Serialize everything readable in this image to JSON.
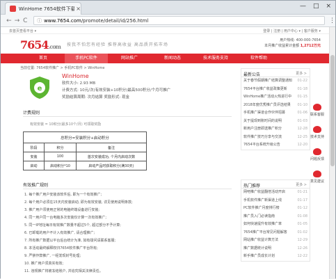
{
  "browser": {
    "tab_title": "WinHome 7654软件下载...",
    "close": "×",
    "window_controls": [
      "—",
      "□",
      "×"
    ],
    "url_host": "www.7654.com",
    "url_path": "/promote/detail/id/256.html",
    "back": "←",
    "forward": "→",
    "reload": "C",
    "menu": "⋮"
  },
  "site": {
    "top_left": "去首页查看平台 ▾",
    "top_right": "登录 | 注册 | 用户中心 ▾ | 客户服务 ▾",
    "logo_main": "7654",
    "logo_suffix": ".com",
    "slogan": "按我不怕您有经验 推荐高收益 高品质开拓市场",
    "hotline": "用户热线: 400-000-7654",
    "earnings_label": "本月推广收益累计金额",
    "earnings_value": "1,2712万元",
    "nav": [
      "首页",
      "手机PC软件",
      "网站推广",
      "新闻动态",
      "技术服务支持",
      "软件帮助"
    ],
    "breadcrumb": "当前位置: 7654软件推广 > 手机PC软件 > WinHome"
  },
  "app": {
    "name": "WinHome",
    "version": "软件大小: 2.93 MB",
    "price": "计费方式: 10元/次(有效安装+10积分)最高500积分/个月可推广",
    "billing": "奖励结算周期: 次月结算  奖励形式: 现金"
  },
  "rules": {
    "title": "计费规则",
    "subtitle": "有效安装 = 10积分(最多10个/月) 可领取奖励",
    "table_caption": "总积分=安装积分+启动积分",
    "headers": [
      "阶段",
      "积分",
      "备注"
    ],
    "rows": [
      [
        "安装",
        "100",
        "首次安装成功, 个月内启动次数"
      ],
      [
        "启动",
        "启动积分*10",
        "启动产品时获取积分(满30天)"
      ]
    ]
  },
  "notes": {
    "title": "有效推广规则",
    "items": [
      "1. 每个推广用户安装该软件后, 即为一个有效推广;",
      "2. 每个用户必须在15天内安装启动, 即为有效安装, 详见使用说明条款;",
      "3. 推广用户须使用正常的电脑终端设备进行安装;",
      "4. 同一用户同一台电脑多次安装仅计算一次有效推广;",
      "5. 同一IP地址每日有效推广数量不超过5个, 超过部分不予计算;",
      "6. 已卸载的用户不计入有效推广, 请合理推广;",
      "7. 所有推广数据以平台后台统计为准, 如有疑问请联系客服;",
      "8. 本活动最终解释权归7654软件推广平台所有;",
      "9. 严禁作弊推广, 一经发现封号处理;",
      "10. 推广用户须真实有效;",
      "11. 违规推广将被冻结账户, 并追究相关法律责任。"
    ]
  },
  "sidebar": {
    "news_title": "最新公告",
    "news_more": "更多 >",
    "news": [
      [
        "关于春节假期推广结算调整通知",
        "01-22"
      ],
      [
        "7654平台推广收益政策更新",
        "01-18"
      ],
      [
        "WinHome推广活动火热进行中",
        "01-15"
      ],
      [
        "2018年度优秀推广员评选结果",
        "01-10"
      ],
      [
        "手机推广渠道合作伙伴招募",
        "01-06"
      ],
      [
        "关于提现到账时间的说明",
        "01-03"
      ],
      [
        "新用户注册即送推广积分",
        "12-28"
      ],
      [
        "软件推广技巧分享与交流",
        "12-25"
      ],
      [
        "7654平台系统升级公告",
        "12-20"
      ]
    ],
    "hot_title": "热门推荐",
    "hot_more": "更多 >",
    "hot": [
      [
        "网吧推广收益翻倍活动开启",
        "01-21"
      ],
      [
        "手机软件推广新渠道上线",
        "01-17"
      ],
      [
        "PC软件推广月度排行榜",
        "01-12"
      ],
      [
        "推广员入门必读指南",
        "01-08"
      ],
      [
        "如何快速提升有效推广率",
        "01-05"
      ],
      [
        "7654推广平台常见问题解答",
        "01-02"
      ],
      [
        "网站推广收益计算方法",
        "12-29"
      ],
      [
        "推广数据统计说明",
        "12-26"
      ],
      [
        "新手推广员成长计划",
        "12-22"
      ]
    ],
    "float": [
      "联系客服",
      "技术支持",
      "问题反馈",
      "意见建议"
    ]
  }
}
